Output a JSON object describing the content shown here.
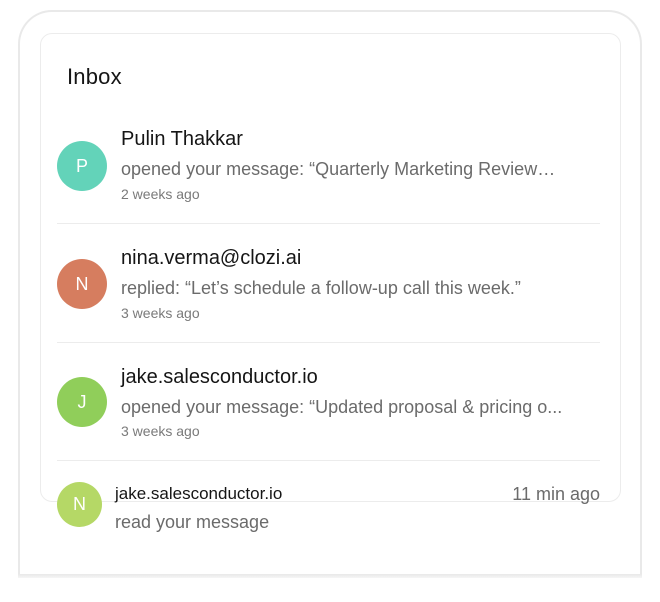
{
  "inbox": {
    "title": "Inbox",
    "items": [
      {
        "initial": "P",
        "color": "#63d3b9",
        "name": "Pulin Thakkar",
        "message": " opened your message: “Quarterly Marketing Review…",
        "time": "2 weeks ago"
      },
      {
        "initial": "N",
        "color": "#d67d5f",
        "name": "nina.verma@clozi.ai",
        "message": "replied: “Let’s schedule a follow-up call this week.”",
        "time": "3 weeks ago"
      },
      {
        "initial": "J",
        "color": "#90ce5a",
        "name": "jake.salesconductor.io",
        "message": "opened your message: “Updated proposal & pricing o...",
        "time": "3 weeks ago"
      }
    ]
  },
  "notification": {
    "initial": "N",
    "color": "#b5d866",
    "name": "jake.salesconductor.io",
    "message": "read your message",
    "time": "11 min ago"
  }
}
